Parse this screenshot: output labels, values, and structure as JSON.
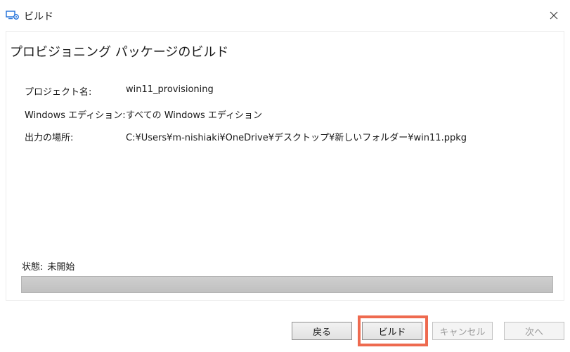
{
  "window": {
    "title": "ビルド",
    "app_icon": "provisioning-app-icon",
    "close_icon": "close-icon"
  },
  "page": {
    "heading": "プロビジョニング パッケージのビルド"
  },
  "details": [
    {
      "label": "プロジェクト名:",
      "value": "win11_provisioning"
    },
    {
      "label": "Windows エディション:",
      "value": "すべての Windows エディション"
    },
    {
      "label": "出力の場所:",
      "value": "C:¥Users¥m-nishiaki¥OneDrive¥デスクトップ¥新しいフォルダー¥win11.ppkg"
    }
  ],
  "status": {
    "label": "状態:",
    "value": "未開始",
    "progress": 0
  },
  "buttons": {
    "back": "戻る",
    "build": "ビルド",
    "cancel": "キャンセル",
    "next": "次へ"
  },
  "colors": {
    "highlight": "#ee6a4f",
    "icon_accent": "#1e6fd9"
  }
}
